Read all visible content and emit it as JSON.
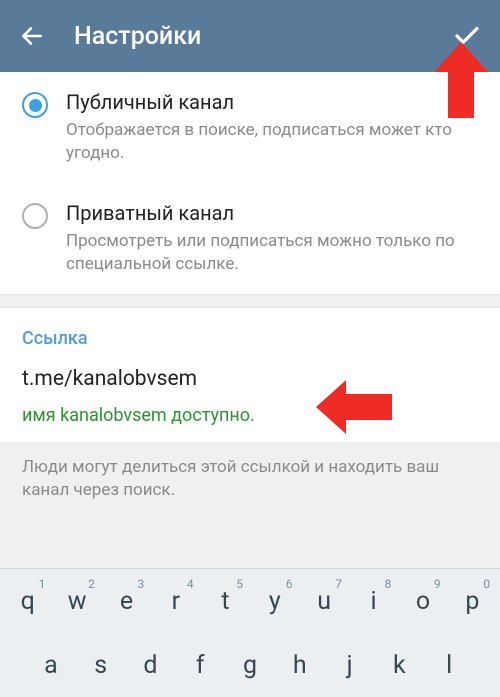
{
  "header": {
    "title": "Настройки"
  },
  "channel_type": {
    "public": {
      "title": "Публичный канал",
      "desc": "Отображается в поиске, подписаться может кто угодно."
    },
    "private": {
      "title": "Приватный канал",
      "desc": "Просмотреть или подписаться можно только по специальной ссылке."
    }
  },
  "link": {
    "label": "Ссылка",
    "value": "t.me/kanalobvsem",
    "status": "имя kanalobvsem доступно."
  },
  "hint": "Люди могут делиться этой ссылкой и находить ваш канал через поиск.",
  "keyboard": {
    "row1": [
      {
        "k": "q",
        "n": "1"
      },
      {
        "k": "w",
        "n": "2"
      },
      {
        "k": "e",
        "n": "3"
      },
      {
        "k": "r",
        "n": "4"
      },
      {
        "k": "t",
        "n": "5"
      },
      {
        "k": "y",
        "n": "6"
      },
      {
        "k": "u",
        "n": "7"
      },
      {
        "k": "i",
        "n": "8"
      },
      {
        "k": "o",
        "n": "9"
      },
      {
        "k": "p",
        "n": "0"
      }
    ],
    "row2": [
      {
        "k": "a"
      },
      {
        "k": "s"
      },
      {
        "k": "d"
      },
      {
        "k": "f"
      },
      {
        "k": "g"
      },
      {
        "k": "h"
      },
      {
        "k": "j"
      },
      {
        "k": "k"
      },
      {
        "k": "l"
      }
    ]
  }
}
